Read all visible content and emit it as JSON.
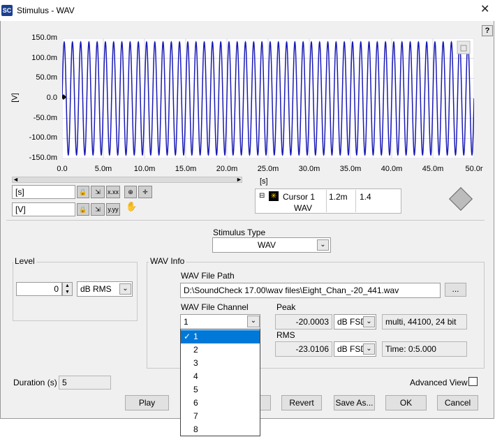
{
  "window": {
    "title": "Stimulus  - WAV",
    "logo": "SC",
    "close": "✕",
    "help": "?"
  },
  "graph": {
    "y_ticks": [
      "150.0m",
      "100.0m",
      "50.0m",
      "0.0",
      "-50.0m",
      "-100.0m",
      "-150.0m"
    ],
    "x_ticks": [
      "0.0",
      "5.0m",
      "10.0m",
      "15.0m",
      "20.0m",
      "25.0m",
      "30.0m",
      "35.0m",
      "40.0m",
      "45.0m",
      "50.0r"
    ],
    "y_unit": "[V]",
    "x_unit": "[s]",
    "x_scale_label": "[s]",
    "y_scale_label": "[V]",
    "trace_color": "#1a1ab4"
  },
  "chart_data": {
    "type": "line",
    "xlabel": "[s]",
    "ylabel": "[V]",
    "xlim": [
      0,
      0.05
    ],
    "ylim": [
      -0.15,
      0.15
    ],
    "grid": true,
    "series": [
      {
        "amplitude": 0.141,
        "frequency_hz": 1000,
        "start_s": 0,
        "end_s": 0.05
      }
    ]
  },
  "cursor_legend": {
    "name": "Cursor 1",
    "trace": "WAV",
    "x_value": "1.2m",
    "y_value": "1.4"
  },
  "stimulus_type": {
    "label": "Stimulus Type",
    "value": "WAV"
  },
  "level": {
    "group_label": "Level",
    "value": "0",
    "unit": "dB RMS"
  },
  "wav_info": {
    "group_label": "WAV Info",
    "path_label": "WAV File Path",
    "path_value": "D:\\SoundCheck 17.00\\wav files\\Eight_Chan_-20_441.wav",
    "browse": "...",
    "channel_label": "WAV File Channel",
    "channel_value": "1",
    "channel_options": [
      "1",
      "2",
      "3",
      "4",
      "5",
      "6",
      "7",
      "8"
    ],
    "selected_check": "✓",
    "peak_label": "Peak",
    "peak_value": "-20.0003",
    "peak_unit": "dB FSD",
    "format_info": "multi, 44100, 24 bit",
    "rms_label": "RMS",
    "rms_value": "-23.0106",
    "rms_unit": "dB FSD",
    "time_info": "Time:  0:5.000"
  },
  "duration": {
    "label": "Duration (s)",
    "value": "5"
  },
  "advanced_view": {
    "label": "Advanced View",
    "checked": false
  },
  "buttons": {
    "play": "Play",
    "revert": "Revert",
    "save_as": "Save As...",
    "ok": "OK",
    "cancel": "Cancel"
  }
}
